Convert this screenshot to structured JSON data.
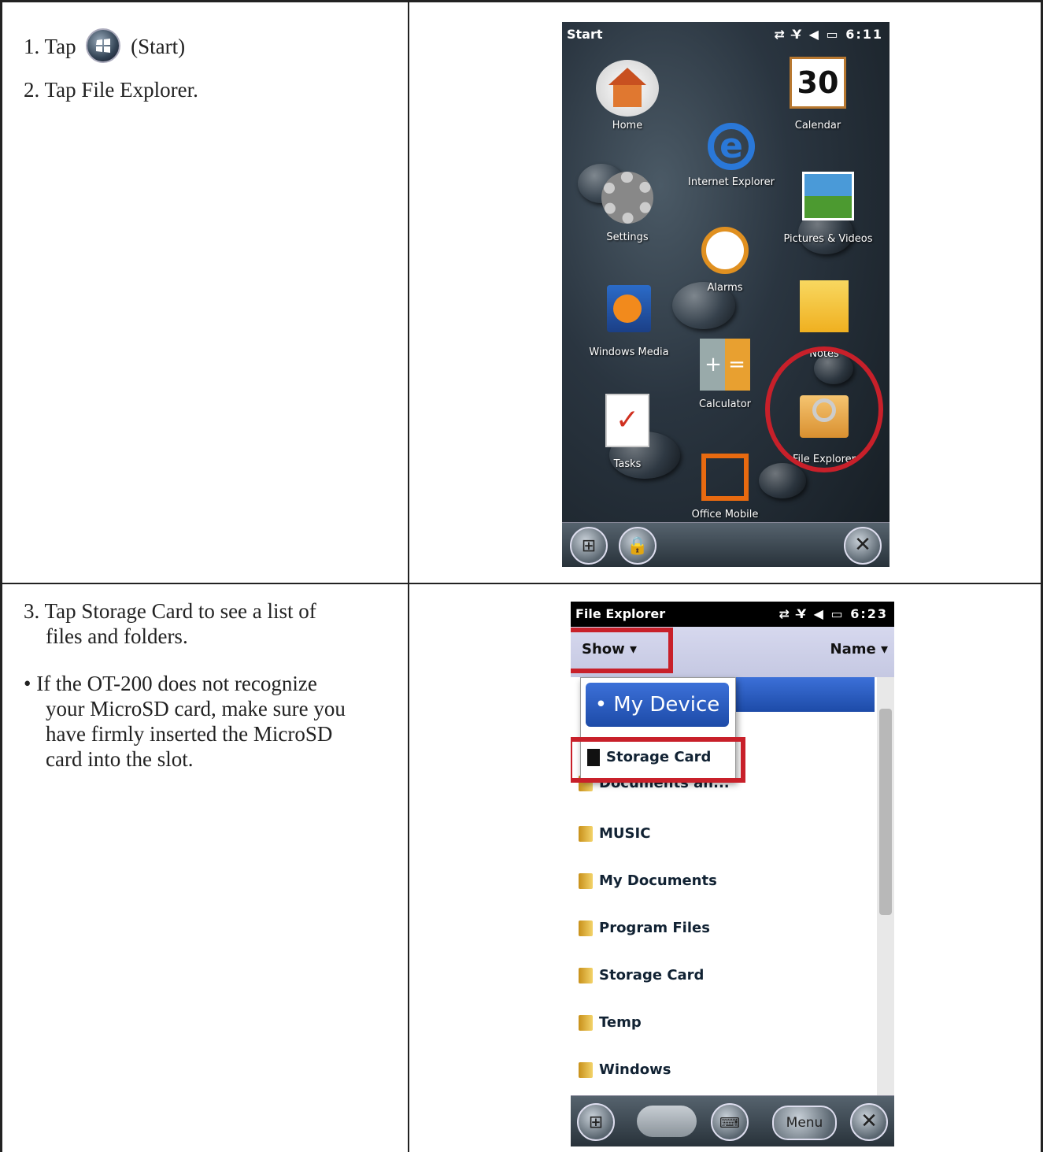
{
  "steps_top": {
    "step1_prefix": "1.  Tap",
    "step1_suffix": "(Start)",
    "step2": "2.  Tap File Explorer."
  },
  "steps_bottom": {
    "step3_line1": "3.  Tap Storage Card to see a list of",
    "step3_line2": "files and folders.",
    "bullet_line1": "•  If the OT-200 does not recognize",
    "bullet_line2": "your MicroSD card, make sure you",
    "bullet_line3": "have firmly inserted the MicroSD",
    "bullet_line4": "card into the slot."
  },
  "start_screen": {
    "title": "Start",
    "status": "⇄ Y̶ ◀ ▭ 6:11",
    "tiles": {
      "home": "Home",
      "calendar": "Calendar",
      "calendar_day": "30",
      "internet_explorer": "Internet Explorer",
      "settings": "Settings",
      "pictures_videos": "Pictures & Videos",
      "alarms": "Alarms",
      "windows_media": "Windows Media",
      "notes": "Notes",
      "calculator": "Calculator",
      "tasks": "Tasks",
      "file_explorer": "File Explorer",
      "office_mobile": "Office Mobile"
    }
  },
  "file_explorer": {
    "title": "File Explorer",
    "status": "⇄ Y̶ ◀ ▭ 6:23",
    "show_label": "Show ▾",
    "name_label": "Name ▾",
    "menu_my_device": "• My Device",
    "menu_storage_card": "Storage Card",
    "items": [
      "Documents an...",
      "MUSIC",
      "My Documents",
      "Program Files",
      "Storage Card",
      "Temp",
      "Windows"
    ],
    "menu_button": "Menu"
  }
}
